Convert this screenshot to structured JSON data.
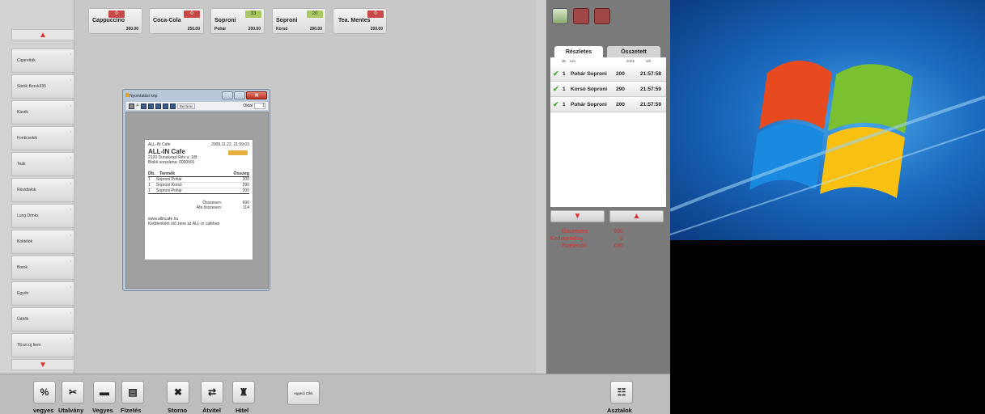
{
  "products": [
    {
      "name": "Cappuccino",
      "sub": "",
      "price": "300.00",
      "count": "0",
      "count_color": "red"
    },
    {
      "name": "Coca-Cola",
      "sub": "",
      "price": "250.00",
      "count": "0",
      "count_color": "red"
    },
    {
      "name": "Soproni",
      "sub": "Pohár",
      "price": "200.00",
      "count": "33",
      "count_color": "green"
    },
    {
      "name": "Soproni",
      "sub": "Korsó",
      "price": "290.00",
      "count": "20",
      "count_color": "green"
    },
    {
      "name": "Tea. Mentes",
      "sub": "",
      "price": "200.00",
      "count": "0",
      "count_color": "red"
    }
  ],
  "sidebar": {
    "items": [
      "Cigaretták",
      "Sörök Borok335",
      "Kávék",
      "Fonticsokik",
      "Teák",
      "Rövidtalok",
      "Lung Drinks",
      "Koktélok",
      "Borok",
      "Egyéb",
      "Üdítők",
      "TEszt új Item"
    ]
  },
  "print_window": {
    "title": "Nyomtatási kép",
    "toolbar_button": "Bezárás",
    "page_label": "Oldal",
    "page_value": "1",
    "receipt": {
      "shop": "ALL-IN Cafe",
      "datetime": "2009.11.22. 21:59:03",
      "title": "ALL-IN Cafe",
      "address": "2120 Dunakeszi Rév u. 1/B",
      "serial": "Blokk sorszáma: 0000091",
      "col_db": "Db.",
      "col_termek": "Termék",
      "col_osszeg": "Összeg",
      "lines": [
        {
          "q": "1",
          "name": "Soproni Pohár",
          "value": "200"
        },
        {
          "q": "1",
          "name": "Soproni Korsó",
          "value": "290"
        },
        {
          "q": "1",
          "name": "Soproni Pohár",
          "value": "200"
        }
      ],
      "total_label": "Összesen:",
      "total_value": "690",
      "vat_label": "Áfa összesen:",
      "vat_value": "114",
      "website": "www.allincafe.hu",
      "footer": "Keddenként élő zene az ALL-in caféban"
    }
  },
  "order_panel": {
    "tab_detailed": "Részletes",
    "tab_summary": "Összetett",
    "col_db": "db",
    "col_nev": "név",
    "col_ertek": "érték",
    "col_ido": "idő",
    "rows": [
      {
        "q": "1",
        "name": "Pohár Soproni",
        "value": "200",
        "time": "21:57:58"
      },
      {
        "q": "1",
        "name": "Korsó Soproni",
        "value": "290",
        "time": "21:57:59"
      },
      {
        "q": "1",
        "name": "Pohár Soproni",
        "value": "200",
        "time": "21:57:59"
      }
    ],
    "total_label": "Összesen:",
    "total_value": "690",
    "discount_label": "Kedvezmény",
    "discount_value": "0",
    "payable_label": "Fizetendő",
    "payable_value": "690"
  },
  "bottom": {
    "btn_percent": "%",
    "lbl_vegyes1": "vegyes",
    "lbl_utalvany": "Utalvány",
    "lbl_vegyes2": "Vegyes",
    "lbl_fizetes": "Fizetés",
    "lbl_storno": "Storno",
    "lbl_atvitel": "Átvitel",
    "lbl_hitel": "Hitel",
    "btn_egyedi": "egyedi Cikk",
    "lbl_asztalok": "Asztalok"
  },
  "colors": {
    "accent_red": "#e03030",
    "count_red": "#c84848",
    "count_green": "#a8c860"
  }
}
